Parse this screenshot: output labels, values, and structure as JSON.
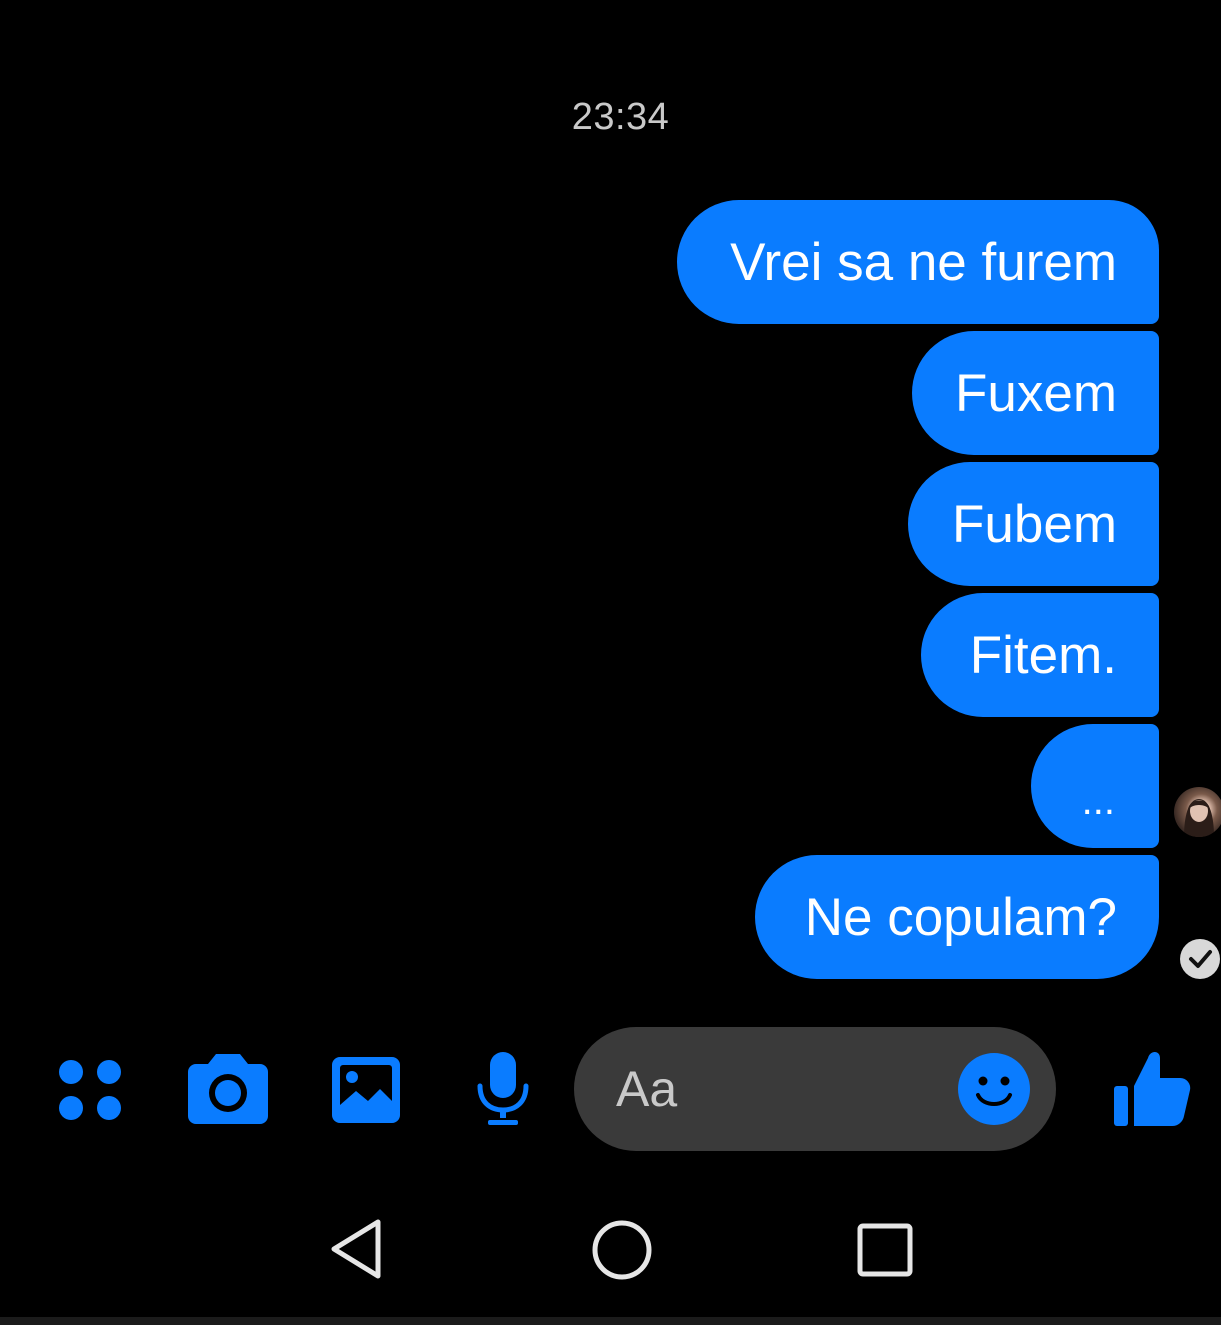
{
  "conversation": {
    "timestamp": "23:34",
    "messages": [
      {
        "text": "Vrei sa ne furem",
        "sender": "me"
      },
      {
        "text": "Fuxem",
        "sender": "me"
      },
      {
        "text": "Fubem",
        "sender": "me"
      },
      {
        "text": "Fitem.",
        "sender": "me"
      },
      {
        "text": "...",
        "sender": "me"
      },
      {
        "text": "Ne copulam?",
        "sender": "me"
      }
    ]
  },
  "composer": {
    "placeholder": "Aa",
    "icons": [
      "apps-icon",
      "camera-icon",
      "gallery-icon",
      "microphone-icon",
      "emoji-icon",
      "thumbs-up-icon"
    ]
  },
  "navigation": {
    "icons": [
      "back-icon",
      "home-icon",
      "recent-apps-icon"
    ]
  },
  "colors": {
    "background": "#000000",
    "bubble": "#0a7cff",
    "accent": "#0a7cff",
    "input_background": "#3a3a3a",
    "timestamp_text": "#c9c9c9"
  }
}
